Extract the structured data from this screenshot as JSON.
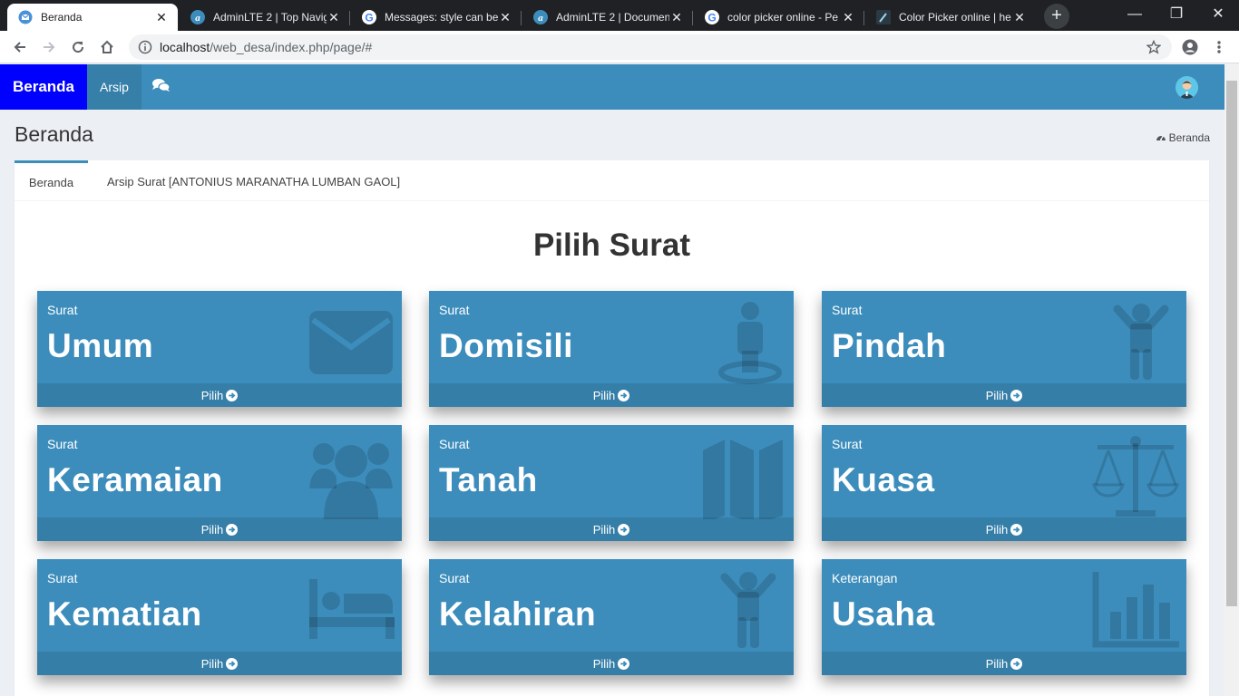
{
  "browser": {
    "tabs": [
      {
        "title": "Beranda",
        "icon": "mail-icon",
        "active": true
      },
      {
        "title": "AdminLTE 2 | Top Navig",
        "icon": "adminlte-icon"
      },
      {
        "title": "Messages: style can be",
        "icon": "google-icon"
      },
      {
        "title": "AdminLTE 2 | Document",
        "icon": "adminlte-icon"
      },
      {
        "title": "color picker online - Pe",
        "icon": "google-icon"
      },
      {
        "title": "Color Picker online | he",
        "icon": "color-picker-icon"
      }
    ],
    "url_host": "localhost",
    "url_path": "/web_desa/index.php/page/#"
  },
  "navbar": {
    "brand": "Beranda",
    "arsip": "Arsip"
  },
  "content": {
    "title": "Beranda",
    "breadcrumb": "Beranda",
    "tabs": [
      "Beranda",
      "Arsip Surat [ANTONIUS MARANATHA LUMBAN GAOL]"
    ],
    "heading": "Pilih Surat"
  },
  "cards": [
    {
      "small": "Surat",
      "big": "Umum",
      "footer": "Pilih",
      "icon": "envelope-icon"
    },
    {
      "small": "Surat",
      "big": "Domisili",
      "footer": "Pilih",
      "icon": "street-view-icon"
    },
    {
      "small": "Surat",
      "big": "Pindah",
      "footer": "Pilih",
      "icon": "child-icon"
    },
    {
      "small": "Surat",
      "big": "Keramaian",
      "footer": "Pilih",
      "icon": "users-icon"
    },
    {
      "small": "Surat",
      "big": "Tanah",
      "footer": "Pilih",
      "icon": "map-icon"
    },
    {
      "small": "Surat",
      "big": "Kuasa",
      "footer": "Pilih",
      "icon": "balance-scale-icon"
    },
    {
      "small": "Surat",
      "big": "Kematian",
      "footer": "Pilih",
      "icon": "bed-icon"
    },
    {
      "small": "Surat",
      "big": "Kelahiran",
      "footer": "Pilih",
      "icon": "child-icon"
    },
    {
      "small": "Keterangan",
      "big": "Usaha",
      "footer": "Pilih",
      "icon": "bar-chart-icon"
    }
  ],
  "colors": {
    "primary": "#3c8dbc",
    "brand": "#0000ff",
    "content_bg": "#ecf0f5"
  }
}
